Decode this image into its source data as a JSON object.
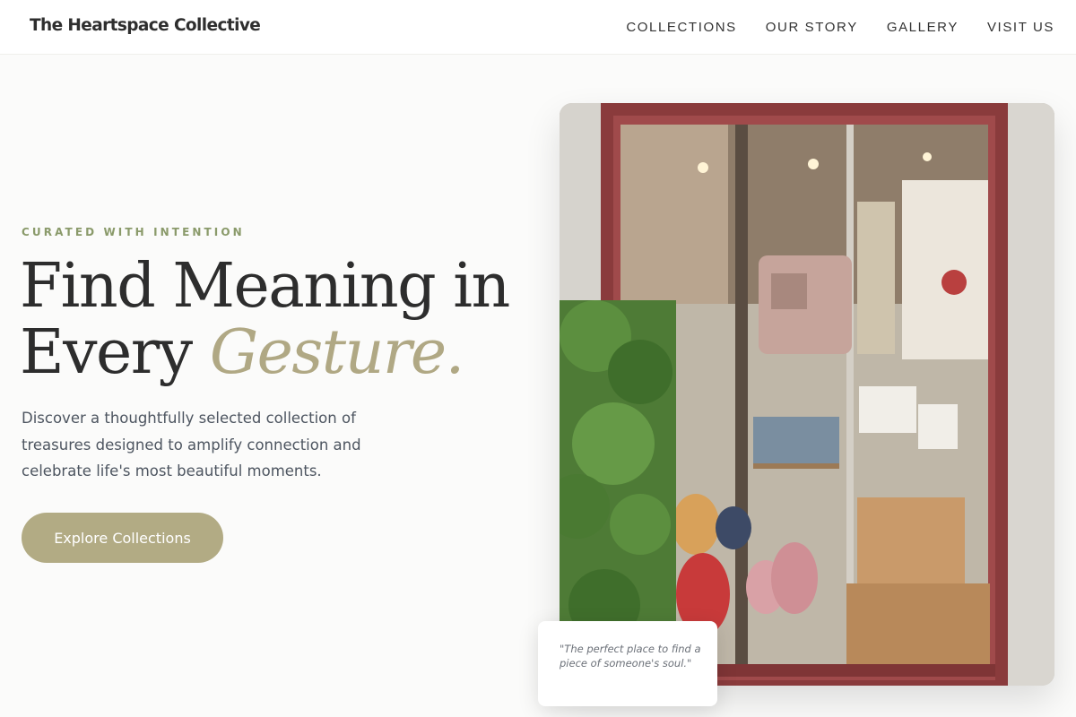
{
  "header": {
    "brand": "The Heartspace Collective",
    "nav": [
      "COLLECTIONS",
      "OUR STORY",
      "GALLERY",
      "VISIT US"
    ]
  },
  "hero": {
    "eyebrow": "CURATED WITH INTENTION",
    "headline_line1": "Find Meaning in",
    "headline_line2_start": "Every ",
    "headline_line2_accent": "Gesture.",
    "description": "Discover a thoughtfully selected collection of treasures designed to amplify connection and celebrate life's most beautiful moments.",
    "cta_label": "Explore Collections"
  },
  "testimonial": {
    "quote": "\"The perfect place to find a piece of someone's soul.\""
  },
  "colors": {
    "accent": "#b2ab84",
    "eyebrow": "#8a9a6a",
    "text": "#2d2d2d"
  }
}
